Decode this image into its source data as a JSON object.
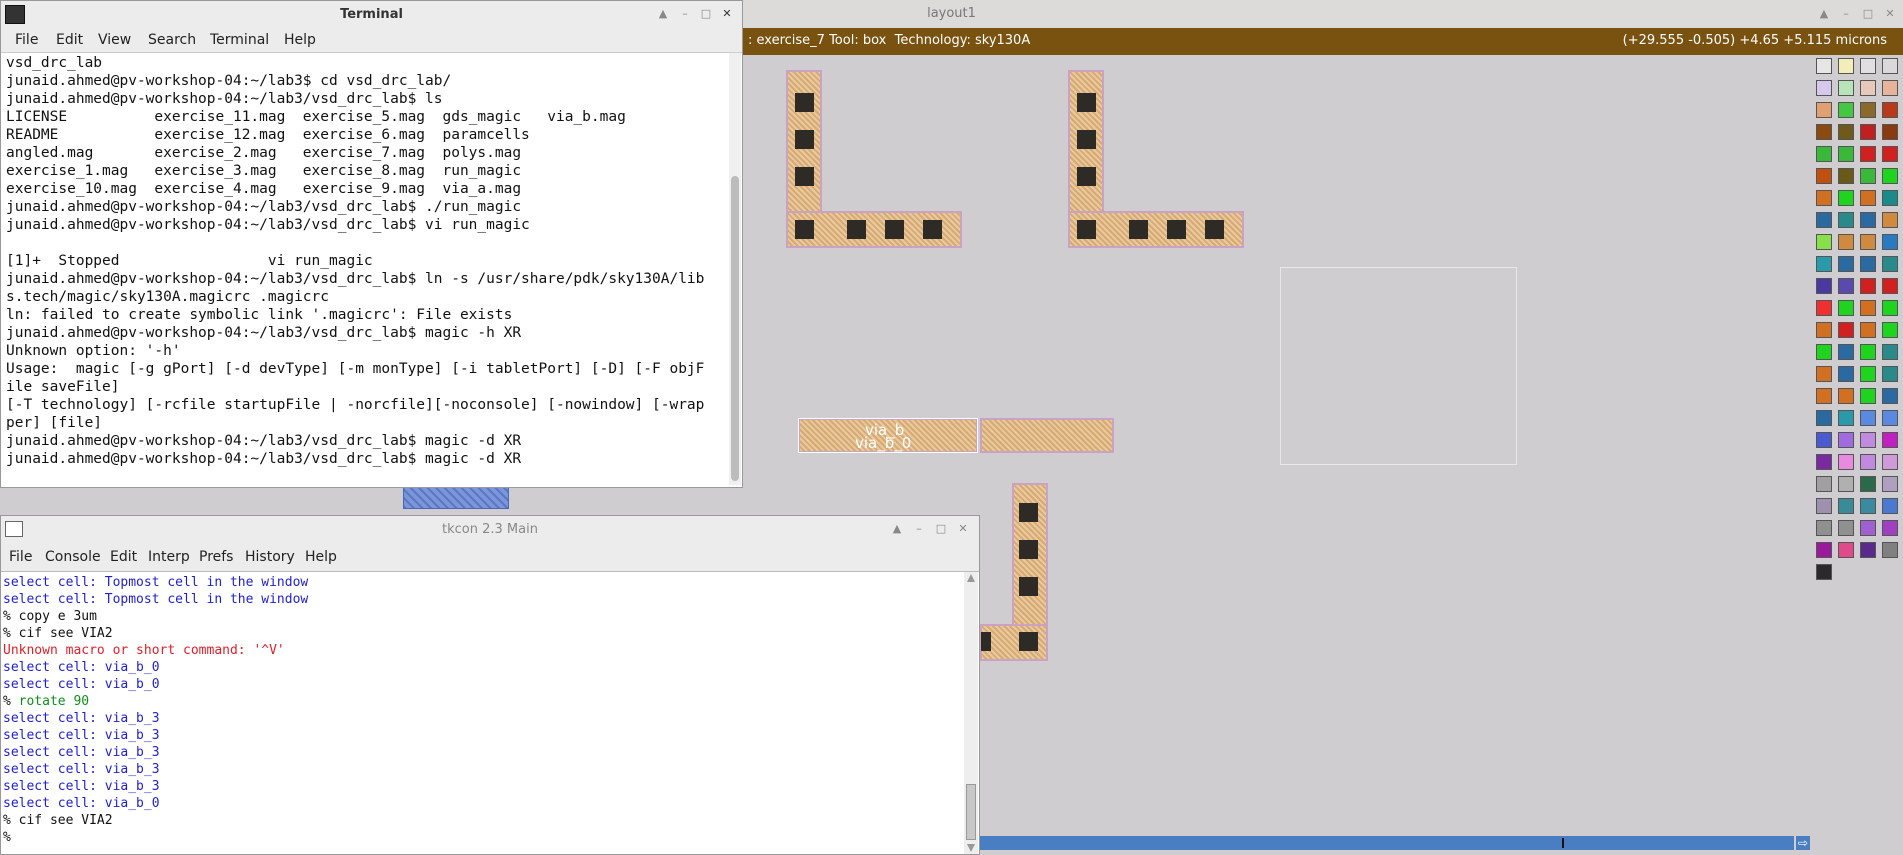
{
  "magic": {
    "title": "layout1",
    "status_left": ": exercise_7 Tool: box  Technology: sky130A",
    "status_right": "(+29.555 -0.505) +4.65 +5.115 microns",
    "cell_labels": [
      "via_b",
      "via_b_0"
    ]
  },
  "terminal": {
    "title": "Terminal",
    "menu": [
      "File",
      "Edit",
      "View",
      "Search",
      "Terminal",
      "Help"
    ],
    "lines": [
      "vsd_drc_lab",
      "junaid.ahmed@pv-workshop-04:~/lab3$ cd vsd_drc_lab/",
      "junaid.ahmed@pv-workshop-04:~/lab3/vsd_drc_lab$ ls",
      "LICENSE          exercise_11.mag  exercise_5.mag  gds_magic   via_b.mag",
      "README           exercise_12.mag  exercise_6.mag  paramcells",
      "angled.mag       exercise_2.mag   exercise_7.mag  polys.mag",
      "exercise_1.mag   exercise_3.mag   exercise_8.mag  run_magic",
      "exercise_10.mag  exercise_4.mag   exercise_9.mag  via_a.mag",
      "junaid.ahmed@pv-workshop-04:~/lab3/vsd_drc_lab$ ./run_magic",
      "junaid.ahmed@pv-workshop-04:~/lab3/vsd_drc_lab$ vi run_magic",
      "",
      "[1]+  Stopped                 vi run_magic",
      "junaid.ahmed@pv-workshop-04:~/lab3/vsd_drc_lab$ ln -s /usr/share/pdk/sky130A/lib",
      "s.tech/magic/sky130A.magicrc .magicrc",
      "ln: failed to create symbolic link '.magicrc': File exists",
      "junaid.ahmed@pv-workshop-04:~/lab3/vsd_drc_lab$ magic -h XR",
      "Unknown option: '-h'",
      "Usage:  magic [-g gPort] [-d devType] [-m monType] [-i tabletPort] [-D] [-F objF",
      "ile saveFile]",
      "[-T technology] [-rcfile startupFile | -norcfile][-noconsole] [-nowindow] [-wrap",
      "per] [file]",
      "junaid.ahmed@pv-workshop-04:~/lab3/vsd_drc_lab$ magic -d XR",
      "junaid.ahmed@pv-workshop-04:~/lab3/vsd_drc_lab$ magic -d XR"
    ]
  },
  "tkcon": {
    "title": "tkcon 2.3 Main",
    "menu": [
      "File",
      "Console",
      "Edit",
      "Interp",
      "Prefs",
      "History",
      "Help"
    ],
    "lines": [
      {
        "prompt": "",
        "text": "select cell: Topmost cell in the window",
        "style": "blue"
      },
      {
        "prompt": "",
        "text": "select cell: Topmost cell in the window",
        "style": "blue"
      },
      {
        "prompt": "% ",
        "text": "copy e 3um",
        "style": "blk"
      },
      {
        "prompt": "% ",
        "text": "cif see VIA2",
        "style": "blk"
      },
      {
        "prompt": "",
        "text": "Unknown macro or short command: '^V'",
        "style": "red"
      },
      {
        "prompt": "",
        "text": "select cell: via_b_0",
        "style": "blue"
      },
      {
        "prompt": "",
        "text": "select cell: via_b_0",
        "style": "blue"
      },
      {
        "prompt": "% ",
        "text": "rotate 90",
        "style": "green"
      },
      {
        "prompt": "",
        "text": "select cell: via_b_3",
        "style": "blue"
      },
      {
        "prompt": "",
        "text": "select cell: via_b_3",
        "style": "blue"
      },
      {
        "prompt": "",
        "text": "select cell: via_b_3",
        "style": "blue"
      },
      {
        "prompt": "",
        "text": "select cell: via_b_3",
        "style": "blue"
      },
      {
        "prompt": "",
        "text": "select cell: via_b_3",
        "style": "blue"
      },
      {
        "prompt": "",
        "text": "select cell: via_b_0",
        "style": "blue"
      },
      {
        "prompt": "% ",
        "text": "cif see VIA2",
        "style": "blk"
      },
      {
        "prompt": "% ",
        "text": "",
        "style": "blk"
      }
    ]
  },
  "palette_colors": [
    "#e6e6e6",
    "#f3eeb8",
    "#e0e0e0",
    "#d9d9d9",
    "#d6c8ea",
    "#b9e3b9",
    "#e7c9b9",
    "#e7b39b",
    "#e1a072",
    "#44c844",
    "#8a6a2a",
    "#b83a1a",
    "#8a4a10",
    "#6e5a1a",
    "#c02020",
    "#8a3a10",
    "#39b839",
    "#39b839",
    "#d02020",
    "#d02020",
    "#c05010",
    "#6a5a1a",
    "#39b839",
    "#1ed41e",
    "#d07020",
    "#1ed41e",
    "#d07020",
    "#1a8a8a",
    "#2a6aa0",
    "#2a8a8a",
    "#2a6aa0",
    "#d08a40",
    "#8ae04a",
    "#d08a40",
    "#d08a40",
    "#2a7ac0",
    "#2a9aaa",
    "#2a6aa0",
    "#2a6aa0",
    "#2a8a8a",
    "#4a3aa0",
    "#5a4ab0",
    "#d02020",
    "#d02020",
    "#ef3030",
    "#1ed41e",
    "#d07020",
    "#1ed41e",
    "#d07020",
    "#d02020",
    "#d07020",
    "#1ed41e",
    "#1ed41e",
    "#2a6aa0",
    "#1ed41e",
    "#2a8a8a",
    "#d07020",
    "#2a6aa0",
    "#1ed41e",
    "#2a8a8a",
    "#d07020",
    "#d07020",
    "#1ed41e",
    "#2a6aa0",
    "#2a6aa0",
    "#2a9aaa",
    "#5a8ae0",
    "#5a8ae0",
    "#4a5ad0",
    "#a06ae0",
    "#c08ae0",
    "#c020c0",
    "#7a2aa0",
    "#e88ae0",
    "#c08ae0",
    "#d09ad8",
    "#a0a0a0",
    "#b0b0b0",
    "#2a6a4a",
    "#b0a0c0",
    "#a090b0",
    "#3a8a9a",
    "#3a8aa0",
    "#4a7ad0",
    "#909090",
    "#909090",
    "#a060d0",
    "#a040c0",
    "#9a1a9a",
    "#e04a8a",
    "#5a2a8a",
    "#808080",
    "#2a2a2a"
  ]
}
